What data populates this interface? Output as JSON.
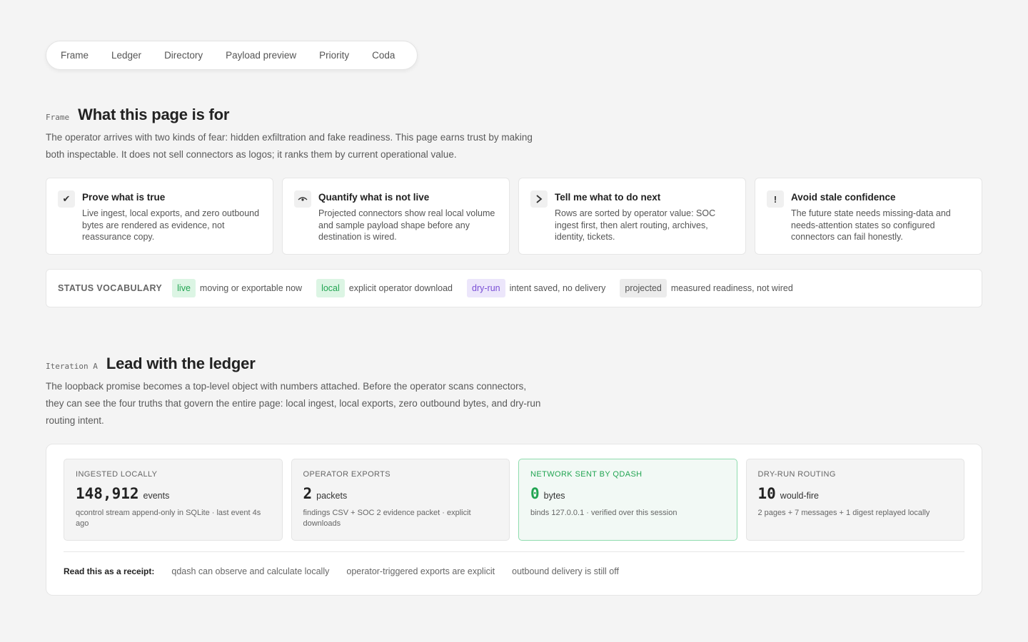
{
  "nav": {
    "tabs": [
      {
        "label": "Frame"
      },
      {
        "label": "Ledger"
      },
      {
        "label": "Directory"
      },
      {
        "label": "Payload preview"
      },
      {
        "label": "Priority"
      },
      {
        "label": "Coda"
      }
    ]
  },
  "frame": {
    "kicker": "Frame",
    "title": "What this page is for",
    "lede_1": "The operator arrives with two kinds of fear: hidden exfiltration and fake readiness. This page earns trust by making",
    "lede_2": "both inspectable. It does not sell connectors as logos; it ranks them by current operational value.",
    "cards": [
      {
        "icon": "check-icon",
        "glyph": "✔",
        "title": "Prove what is true",
        "body": "Live ingest, local exports, and zero outbound bytes are rendered as evidence, not reassurance copy."
      },
      {
        "icon": "eye-icon",
        "glyph": "◠",
        "title": "Quantify what is not live",
        "body": "Projected connectors show real local volume and sample payload shape before any destination is wired."
      },
      {
        "icon": "chevron-right-icon",
        "glyph": "›",
        "title": "Tell me what to do next",
        "body": "Rows are sorted by operator value: SOC ingest first, then alert routing, archives, identity, tickets."
      },
      {
        "icon": "exclamation-icon",
        "glyph": "!",
        "title": "Avoid stale confidence",
        "body": "The future state needs missing-data and needs-attention states so configured connectors can fail honestly."
      }
    ]
  },
  "vocab": {
    "label": "STATUS VOCABULARY",
    "items": [
      {
        "chip": "live",
        "desc": "moving or exportable now",
        "color": "#22a552"
      },
      {
        "chip": "local",
        "desc": "explicit operator download",
        "color": "#22a552"
      },
      {
        "chip": "dry-run",
        "desc": "intent saved, no delivery",
        "color": "#7a4fd6"
      },
      {
        "chip": "projected",
        "desc": "measured readiness, not wired",
        "color": "#555555"
      }
    ]
  },
  "iteration": {
    "kicker": "Iteration A",
    "title": "Lead with the ledger",
    "lede_1": "The loopback promise becomes a top-level object with numbers attached. Before the operator scans connectors,",
    "lede_2": "they can see the four truths that govern the entire page: local ingest, local exports, zero outbound bytes, and dry-run",
    "lede_3": "routing intent."
  },
  "ledger": {
    "metrics": [
      {
        "label": "INGESTED LOCALLY",
        "value": "148,912",
        "unit": "events",
        "note": "qcontrol stream append-only in SQLite · last event 4s ago"
      },
      {
        "label": "OPERATOR EXPORTS",
        "value": "2",
        "unit": "packets",
        "note": "findings CSV + SOC 2 evidence packet · explicit downloads"
      },
      {
        "label": "NETWORK SENT BY QDASH",
        "value": "0",
        "unit": "bytes",
        "note": "binds 127.0.0.1 · verified over this session"
      },
      {
        "label": "DRY-RUN ROUTING",
        "value": "10",
        "unit": "would-fire",
        "note": "2 pages + 7 messages + 1 digest replayed locally"
      }
    ],
    "receipt_label": "Read this as a receipt:",
    "receipt_items": [
      "qdash can observe and calculate locally",
      "operator-triggered exports are explicit",
      "outbound delivery is still off"
    ]
  },
  "colors": {
    "accent_green": "#22a552",
    "accent_purple": "#7a4fd6",
    "background": "#f4f4f4"
  }
}
